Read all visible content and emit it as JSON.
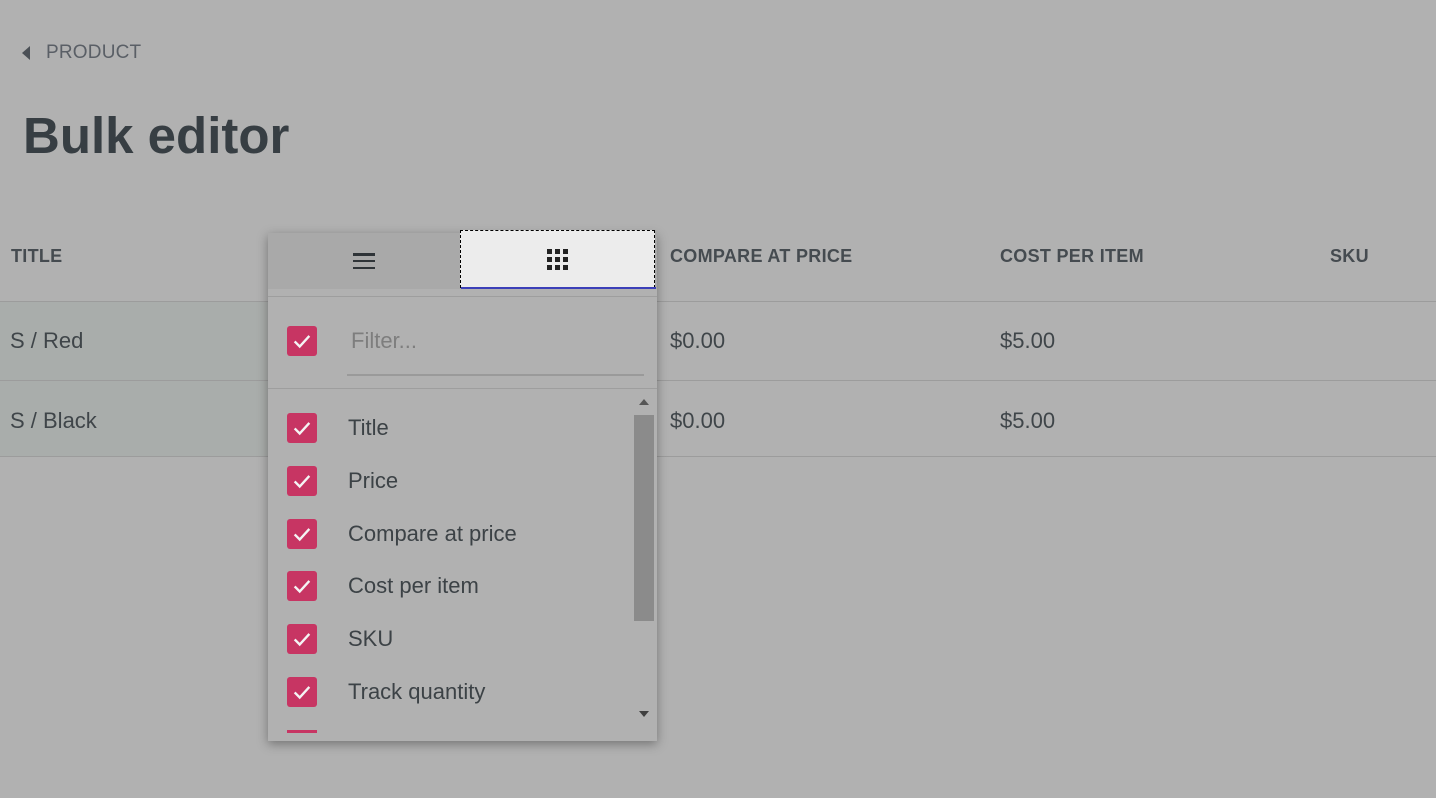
{
  "breadcrumb": {
    "label": "PRODUCT",
    "icon": "chevron-left-icon"
  },
  "page": {
    "title": "Bulk editor"
  },
  "grid": {
    "columns": [
      "TITLE",
      "COMPARE AT PRICE",
      "COST PER ITEM",
      "SKU"
    ],
    "rows": [
      {
        "title": "S / Red",
        "compare_at_price": "$0.00",
        "cost_per_item": "$5.00",
        "sku": ""
      },
      {
        "title": "S / Black",
        "compare_at_price": "$0.00",
        "cost_per_item": "$5.00",
        "sku": ""
      }
    ]
  },
  "column_menu": {
    "tabs": [
      {
        "name": "general",
        "icon": "hamburger-menu-icon",
        "active": false
      },
      {
        "name": "columns",
        "icon": "grid-dots-icon",
        "active": true
      }
    ],
    "filter_placeholder": "Filter...",
    "select_all_checked": true,
    "items": [
      {
        "label": "Title",
        "checked": true
      },
      {
        "label": "Price",
        "checked": true
      },
      {
        "label": "Compare at price",
        "checked": true
      },
      {
        "label": "Cost per item",
        "checked": true
      },
      {
        "label": "SKU",
        "checked": true
      },
      {
        "label": "Track quantity",
        "checked": true
      }
    ],
    "checkbox_color": "#c73563"
  }
}
